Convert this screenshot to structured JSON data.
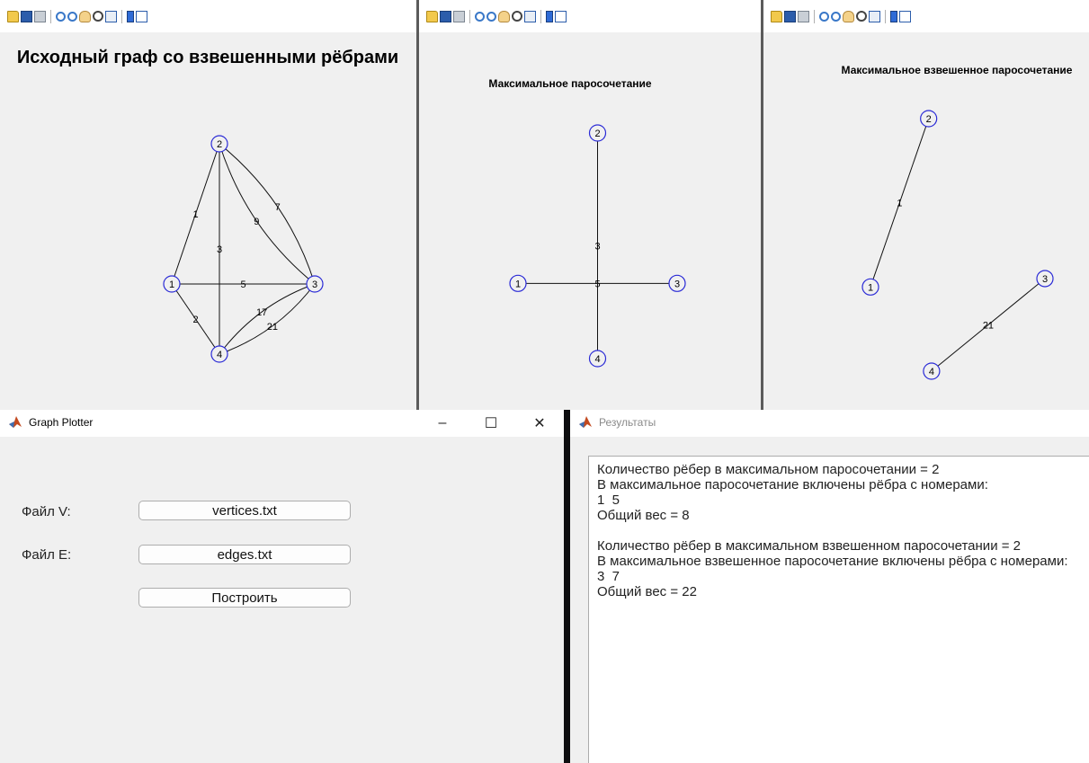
{
  "figures": [
    {
      "title": "Исходный граф со взвешенными рёбрами",
      "nodes": [
        {
          "id": "1",
          "x": 0,
          "y": 2
        },
        {
          "id": "2",
          "x": 2,
          "y": 6
        },
        {
          "id": "3",
          "x": 6,
          "y": 2
        },
        {
          "id": "4",
          "x": 2,
          "y": 0
        }
      ],
      "edges": [
        {
          "from": "1",
          "to": "2",
          "weight": "1"
        },
        {
          "from": "1",
          "to": "4",
          "weight": "2"
        },
        {
          "from": "2",
          "to": "4",
          "weight": "3"
        },
        {
          "from": "1",
          "to": "3",
          "weight": "5"
        },
        {
          "from": "2",
          "to": "3",
          "weight": "7",
          "curve": -0.15
        },
        {
          "from": "2",
          "to": "3",
          "weight": "9",
          "curve": 0.15
        },
        {
          "from": "3",
          "to": "4",
          "weight": "21",
          "curve": -0.15
        },
        {
          "from": "3",
          "to": "4",
          "weight": "17",
          "curve": 0.15
        }
      ]
    },
    {
      "title": "Максимальное паросочетание",
      "nodes": [
        {
          "id": "1",
          "x": 0,
          "y": 2
        },
        {
          "id": "2",
          "x": 3,
          "y": 6
        },
        {
          "id": "3",
          "x": 6,
          "y": 2
        },
        {
          "id": "4",
          "x": 3,
          "y": 0
        }
      ],
      "edges": [
        {
          "from": "2",
          "to": "4",
          "weight": "3"
        },
        {
          "from": "1",
          "to": "3",
          "weight": "5"
        }
      ]
    },
    {
      "title": "Максимальное взвешенное паросочетание",
      "nodes": [
        {
          "id": "1",
          "x": 0,
          "y": 2
        },
        {
          "id": "2",
          "x": 2,
          "y": 6
        },
        {
          "id": "3",
          "x": 6,
          "y": 2.2
        },
        {
          "id": "4",
          "x": 2.1,
          "y": 0
        }
      ],
      "edges": [
        {
          "from": "1",
          "to": "2",
          "weight": "1"
        },
        {
          "from": "4",
          "to": "3",
          "weight": "21"
        }
      ]
    }
  ],
  "plotter": {
    "title": "Graph Plotter",
    "controls": {
      "minimize": "–",
      "maximize": "☐",
      "close": "✕"
    },
    "file_v_label": "Файл V:",
    "file_v_value": "vertices.txt",
    "file_e_label": "Файл E:",
    "file_e_value": "edges.txt",
    "build_label": "Построить"
  },
  "results": {
    "title": "Результаты",
    "text": "Количество рёбер в максимальном паросочетании = 2\nВ максимальное паросочетание включены рёбра с номерами:\n1  5\nОбщий вес = 8\n\nКоличество рёбер в максимальном взвешенном паросочетании = 2\nВ максимальное взвешенное паросочетание включены рёбра с номерами:\n3  7\nОбщий вес = 22"
  },
  "colors": {
    "node_stroke": "#2b2bd6",
    "edge": "#111111",
    "figure_bg": "#f0f0f0"
  }
}
